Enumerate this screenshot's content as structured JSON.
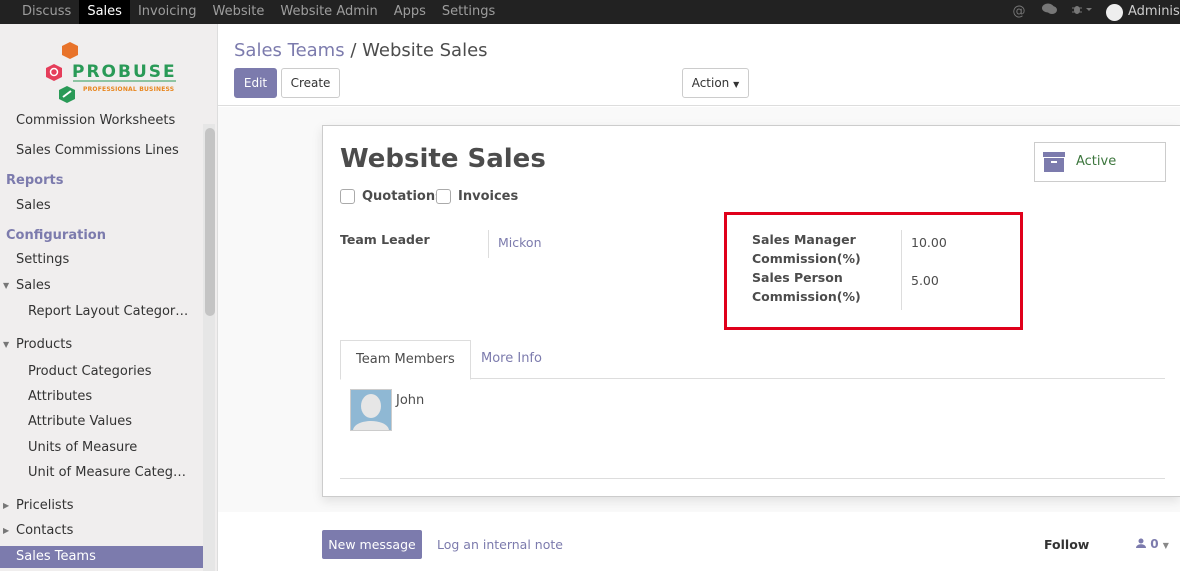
{
  "topnav": {
    "items": [
      "Discuss",
      "Sales",
      "Invoicing",
      "Website",
      "Website Admin",
      "Apps",
      "Settings"
    ],
    "active": "Sales",
    "user": "Administrator"
  },
  "logo": {
    "name": "PROBUSE",
    "tagline": "PROFESSIONAL BUSINESS"
  },
  "sidebar": {
    "items": [
      {
        "label": "Commission Worksheets"
      },
      {
        "label": "Sales Commissions Lines"
      },
      {
        "label": "Reports"
      },
      {
        "label": "Sales"
      },
      {
        "label": "Configuration"
      },
      {
        "label": "Settings"
      },
      {
        "label": "Sales"
      },
      {
        "label": "Report Layout Categor…"
      },
      {
        "label": "Products"
      },
      {
        "label": "Product Categories"
      },
      {
        "label": "Attributes"
      },
      {
        "label": "Attribute Values"
      },
      {
        "label": "Units of Measure"
      },
      {
        "label": "Unit of Measure Categ…"
      },
      {
        "label": "Pricelists"
      },
      {
        "label": "Contacts"
      },
      {
        "label": "Sales Teams"
      }
    ]
  },
  "breadcrumb": {
    "parent": "Sales Teams",
    "separator": "/",
    "current": "Website Sales"
  },
  "buttons": {
    "edit": "Edit",
    "create": "Create",
    "action": "Action"
  },
  "form": {
    "title": "Website Sales",
    "checkboxes": [
      "Quotations",
      "Invoices"
    ],
    "status": "Active",
    "team_leader_label": "Team Leader",
    "team_leader_value": "Mickon",
    "manager_commission_label": "Sales Manager Commission(%)",
    "manager_commission_value": "10.00",
    "person_commission_label": "Sales Person Commission(%)",
    "person_commission_value": "5.00",
    "tabs": [
      "Team Members",
      "More Info"
    ],
    "members": [
      "John"
    ]
  },
  "chatter": {
    "new_message": "New message",
    "log_note": "Log an internal note",
    "follow": "Follow",
    "followers_count": "0"
  },
  "colors": {
    "primary": "#7c7bad",
    "highlight": "#e0001b",
    "active_status": "#3c763d"
  }
}
